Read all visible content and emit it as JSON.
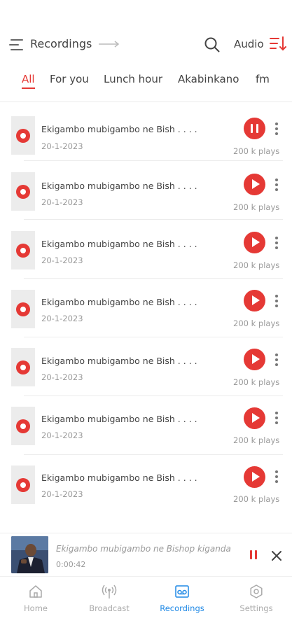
{
  "header": {
    "title": "Recordings",
    "audio_label": "Audio",
    "icons": [
      "hamburger-menu-icon",
      "arrow-right-icon",
      "search-icon",
      "sort-icon"
    ]
  },
  "tabs": [
    {
      "label": "All",
      "active": true
    },
    {
      "label": "For you",
      "active": false
    },
    {
      "label": "Lunch hour",
      "active": false
    },
    {
      "label": "Akabinkano",
      "active": false
    },
    {
      "label": "fm",
      "active": false
    }
  ],
  "recordings": [
    {
      "title": "Ekigambo mubigambo ne Bish . . . .",
      "date": "20-1-2023",
      "plays": "200 k plays",
      "state": "playing"
    },
    {
      "title": "Ekigambo mubigambo ne Bish . . . .",
      "date": "20-1-2023",
      "plays": "200 k plays",
      "state": "paused"
    },
    {
      "title": "Ekigambo mubigambo ne Bish . . . .",
      "date": "20-1-2023",
      "plays": "200 k plays",
      "state": "paused"
    },
    {
      "title": "Ekigambo mubigambo ne Bish . . . .",
      "date": "20-1-2023",
      "plays": "200 k plays",
      "state": "paused"
    },
    {
      "title": "Ekigambo mubigambo ne Bish . . . .",
      "date": "20-1-2023",
      "plays": "200 k plays",
      "state": "paused"
    },
    {
      "title": "Ekigambo mubigambo ne Bish . . . .",
      "date": "20-1-2023",
      "plays": "200 k plays",
      "state": "paused"
    },
    {
      "title": "Ekigambo mubigambo ne Bish . . . .",
      "date": "20-1-2023",
      "plays": "200 k plays",
      "state": "paused"
    }
  ],
  "mini_player": {
    "title": "Ekigambo mubigambo ne Bishop kiganda",
    "time": "0:00:42",
    "state": "playing"
  },
  "bottom_nav": [
    {
      "label": "Home",
      "icon": "home-icon",
      "active": false
    },
    {
      "label": "Broadcast",
      "icon": "broadcast-icon",
      "active": false
    },
    {
      "label": "Recordings",
      "icon": "recordings-icon",
      "active": true
    },
    {
      "label": "Settings",
      "icon": "settings-icon",
      "active": false
    }
  ],
  "colors": {
    "accent": "#e53935",
    "nav_active": "#1e88e5",
    "muted_text": "#999999"
  }
}
